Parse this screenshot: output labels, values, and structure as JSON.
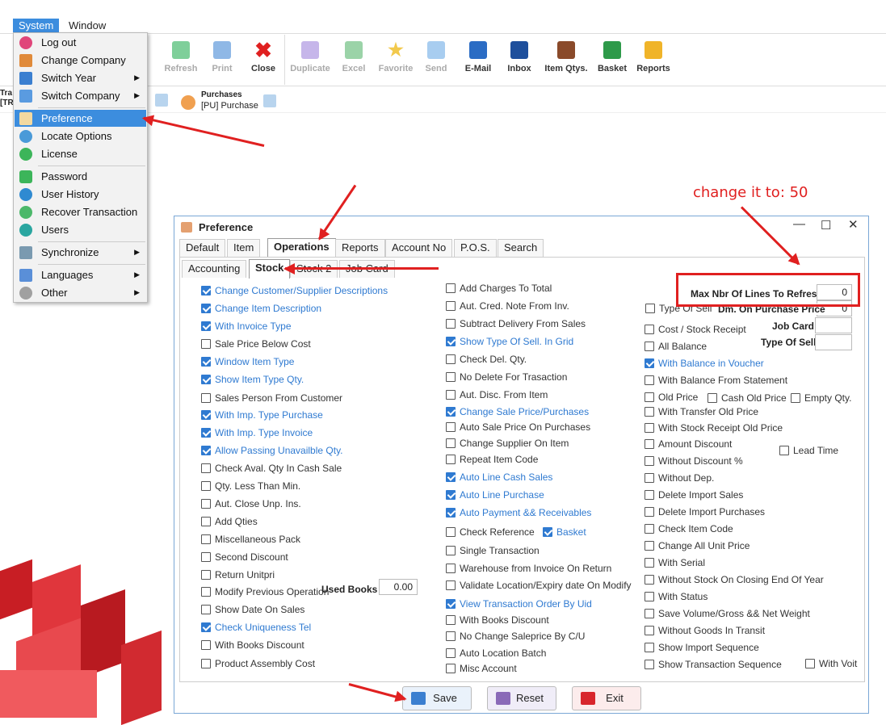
{
  "menubar": {
    "system": "System",
    "window": "Window"
  },
  "toolbar": {
    "items": [
      {
        "label": "Refresh"
      },
      {
        "label": "Print"
      },
      {
        "label": "Close"
      },
      {
        "label": "Duplicate"
      },
      {
        "label": "Excel"
      },
      {
        "label": "Favorite"
      },
      {
        "label": "Send"
      },
      {
        "label": "E-Mail"
      },
      {
        "label": "Inbox"
      },
      {
        "label": "Item Qtys."
      },
      {
        "label": "Basket"
      },
      {
        "label": "Reports"
      }
    ]
  },
  "subtool": {
    "left_partial": "Tra\n[TR",
    "purchases_title": "Purchases",
    "purchases_sub": "[PU] Purchase"
  },
  "menu": {
    "items": [
      "Log out",
      "Change Company",
      "Switch Year",
      "Switch Company",
      "Preference",
      "Locate Options",
      "License",
      "Password",
      "User History",
      "Recover Transaction",
      "Users",
      "Synchronize",
      "Languages",
      "Other"
    ]
  },
  "annotation": {
    "text": "change it to: 50"
  },
  "window": {
    "title": "Preference",
    "tabs": [
      "Default",
      "Item",
      "Operations",
      "Reports",
      "Account No",
      "P.O.S.",
      "Search"
    ],
    "subtabs": [
      "Accounting",
      "Stock",
      "Stock 2",
      "Job Card"
    ],
    "col1": [
      {
        "label": "Change Customer/Supplier Descriptions",
        "checked": true
      },
      {
        "label": "Change Item Description",
        "checked": true
      },
      {
        "label": "With Invoice Type",
        "checked": true
      },
      {
        "label": "Sale Price Below Cost",
        "checked": false
      },
      {
        "label": "Window Item Type",
        "checked": true
      },
      {
        "label": "Show Item Type Qty.",
        "checked": true
      },
      {
        "label": "Sales Person From Customer",
        "checked": false
      },
      {
        "label": "With Imp. Type Purchase",
        "checked": true
      },
      {
        "label": "With Imp. Type Invoice",
        "checked": true
      },
      {
        "label": "Allow Passing Unavailble Qty.",
        "checked": true
      },
      {
        "label": "Check Aval. Qty In Cash Sale",
        "checked": false
      },
      {
        "label": "Qty. Less Than Min.",
        "checked": false
      },
      {
        "label": "Aut. Close Unp. Ins.",
        "checked": false
      },
      {
        "label": "Add Qties",
        "checked": false
      },
      {
        "label": "Miscellaneous Pack",
        "checked": false
      },
      {
        "label": "Second Discount",
        "checked": false
      },
      {
        "label": "Return Unitpri",
        "checked": false
      },
      {
        "label": "Modify Previous Operation",
        "checked": false
      },
      {
        "label": "Show Date On Sales",
        "checked": false
      },
      {
        "label": "Check Uniqueness Tel",
        "checked": true
      },
      {
        "label": "With Books Discount",
        "checked": false
      },
      {
        "label": "Product Assembly Cost",
        "checked": false
      }
    ],
    "used_books_label": "Used Books",
    "used_books_value": "0.00",
    "col2": [
      {
        "label": "Add Charges To Total",
        "checked": false
      },
      {
        "label": "Aut. Cred. Note From Inv.",
        "checked": false
      },
      {
        "label": "Subtract Delivery From Sales",
        "checked": false
      },
      {
        "label": "Show Type Of Sell. In Grid",
        "checked": true
      },
      {
        "label": "Check Del. Qty.",
        "checked": false
      },
      {
        "label": "No Delete For Trasaction",
        "checked": false
      },
      {
        "label": "Aut. Disc. From Item",
        "checked": false
      },
      {
        "label": "Change Sale Price/Purchases",
        "checked": true
      },
      {
        "label": "Auto Sale Price On Purchases",
        "checked": false
      },
      {
        "label": "Change Supplier On Item",
        "checked": false
      },
      {
        "label": "Repeat Item Code",
        "checked": false
      },
      {
        "label": "Auto Line Cash Sales",
        "checked": true
      },
      {
        "label": "Auto Line Purchase",
        "checked": true
      },
      {
        "label": "Auto Payment && Receivables",
        "checked": true
      },
      {
        "label": "Check Reference",
        "checked": false
      },
      {
        "label": "Single Transaction",
        "checked": false
      },
      {
        "label": "Warehouse from Invoice On Return",
        "checked": false
      },
      {
        "label": "Validate Location/Expiry date On Modify",
        "checked": false
      },
      {
        "label": "View Transaction Order By Uid",
        "checked": true
      },
      {
        "label": "With Books Discount",
        "checked": false
      },
      {
        "label": "No Change Saleprice By C/U",
        "checked": false
      },
      {
        "label": "Auto Location Batch",
        "checked": false
      },
      {
        "label": "Misc Account",
        "checked": false
      }
    ],
    "basket": {
      "label": "Basket",
      "checked": true
    },
    "max_lines_label": "Max Nbr Of Lines To Refresh",
    "max_lines_value": "0",
    "type_of_sell_cb": "Type Of Sell",
    "dm_purchase_label": "Dm. On Purchase Price",
    "dm_purchase_value": "0",
    "job_card_label": "Job Card",
    "type_of_sell_label": "Type Of Sell",
    "col3": [
      {
        "label": "Cost / Stock Receipt",
        "checked": false
      },
      {
        "label": "All Balance",
        "checked": false
      },
      {
        "label": "With Balance in Voucher",
        "checked": true
      },
      {
        "label": "With Balance From Statement",
        "checked": false
      },
      {
        "label": "Old Price",
        "checked": false
      },
      {
        "label": "With Transfer Old Price",
        "checked": false
      },
      {
        "label": "With Stock Receipt Old Price",
        "checked": false
      },
      {
        "label": "Amount Discount",
        "checked": false
      },
      {
        "label": "Without Discount %",
        "checked": false
      },
      {
        "label": "Without Dep.",
        "checked": false
      },
      {
        "label": "Delete Import Sales",
        "checked": false
      },
      {
        "label": "Delete Import Purchases",
        "checked": false
      },
      {
        "label": "Check Item Code",
        "checked": false
      },
      {
        "label": "Change All Unit Price",
        "checked": false
      },
      {
        "label": "With Serial",
        "checked": false
      },
      {
        "label": "Without Stock On Closing End Of Year",
        "checked": false
      },
      {
        "label": "With Status",
        "checked": false
      },
      {
        "label": "Save Volume/Gross && Net Weight",
        "checked": false
      },
      {
        "label": "Without Goods In Transit",
        "checked": false
      },
      {
        "label": "Show Import Sequence",
        "checked": false
      },
      {
        "label": "Show Transaction Sequence",
        "checked": false
      }
    ],
    "cash_old_price": {
      "label": "Cash Old Price",
      "checked": false
    },
    "empty_qty": {
      "label": "Empty Qty.",
      "checked": false
    },
    "lead_time": {
      "label": "Lead Time",
      "checked": false
    },
    "with_voit": {
      "label": "With Voit",
      "checked": false
    },
    "buttons": {
      "save": "Save",
      "reset": "Reset",
      "exit": "Exit"
    }
  }
}
